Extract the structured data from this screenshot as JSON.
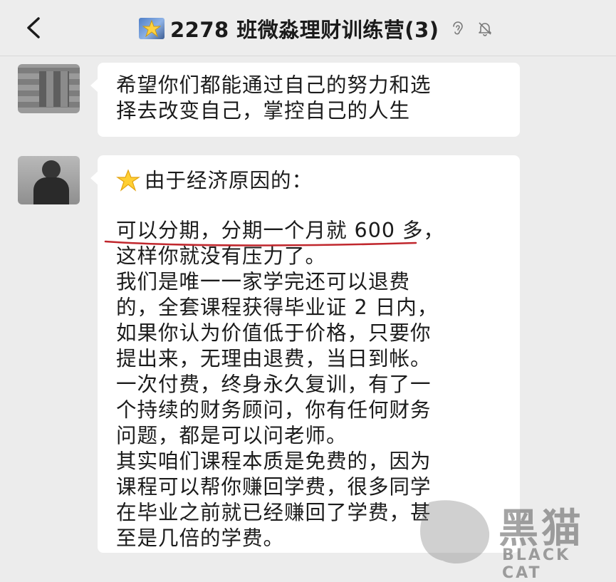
{
  "header": {
    "title": "2278 班微淼理财训练营(3)",
    "back_icon": "chevron-left-icon",
    "ear_icon": "ear-icon",
    "mute_icon": "bell-muted-icon"
  },
  "messages": [
    {
      "lines": [
        "希望你们都能通过自己的努力和选",
        "择去改变自己，掌控自己的人生"
      ]
    },
    {
      "lead": "由于经济原因的：",
      "lines": [
        "可以分期，分期一个月就 600 多，",
        "这样你就没有压力了。",
        "我们是唯一一家学完还可以退费",
        "的，全套课程获得毕业证 2 日内，",
        "如果你认为价值低于价格，只要你",
        "提出来，无理由退费，当日到帐。",
        "一次付费，终身永久复训，有了一",
        "个持续的财务顾问，你有任何财务",
        "问题，都是可以问老师。",
        "其实咱们课程本质是免费的，因为",
        "课程可以帮你赚回学费，很多同学",
        "在毕业之前就已经赚回了学费，甚",
        "至是几倍的学费。"
      ]
    }
  ],
  "watermark": {
    "cn": "黑猫",
    "en": "BLACK CAT"
  },
  "colors": {
    "header_bg": "#ededed",
    "chat_bg": "#ececec",
    "bubble_bg": "#ffffff",
    "underline": "#c0272d"
  }
}
